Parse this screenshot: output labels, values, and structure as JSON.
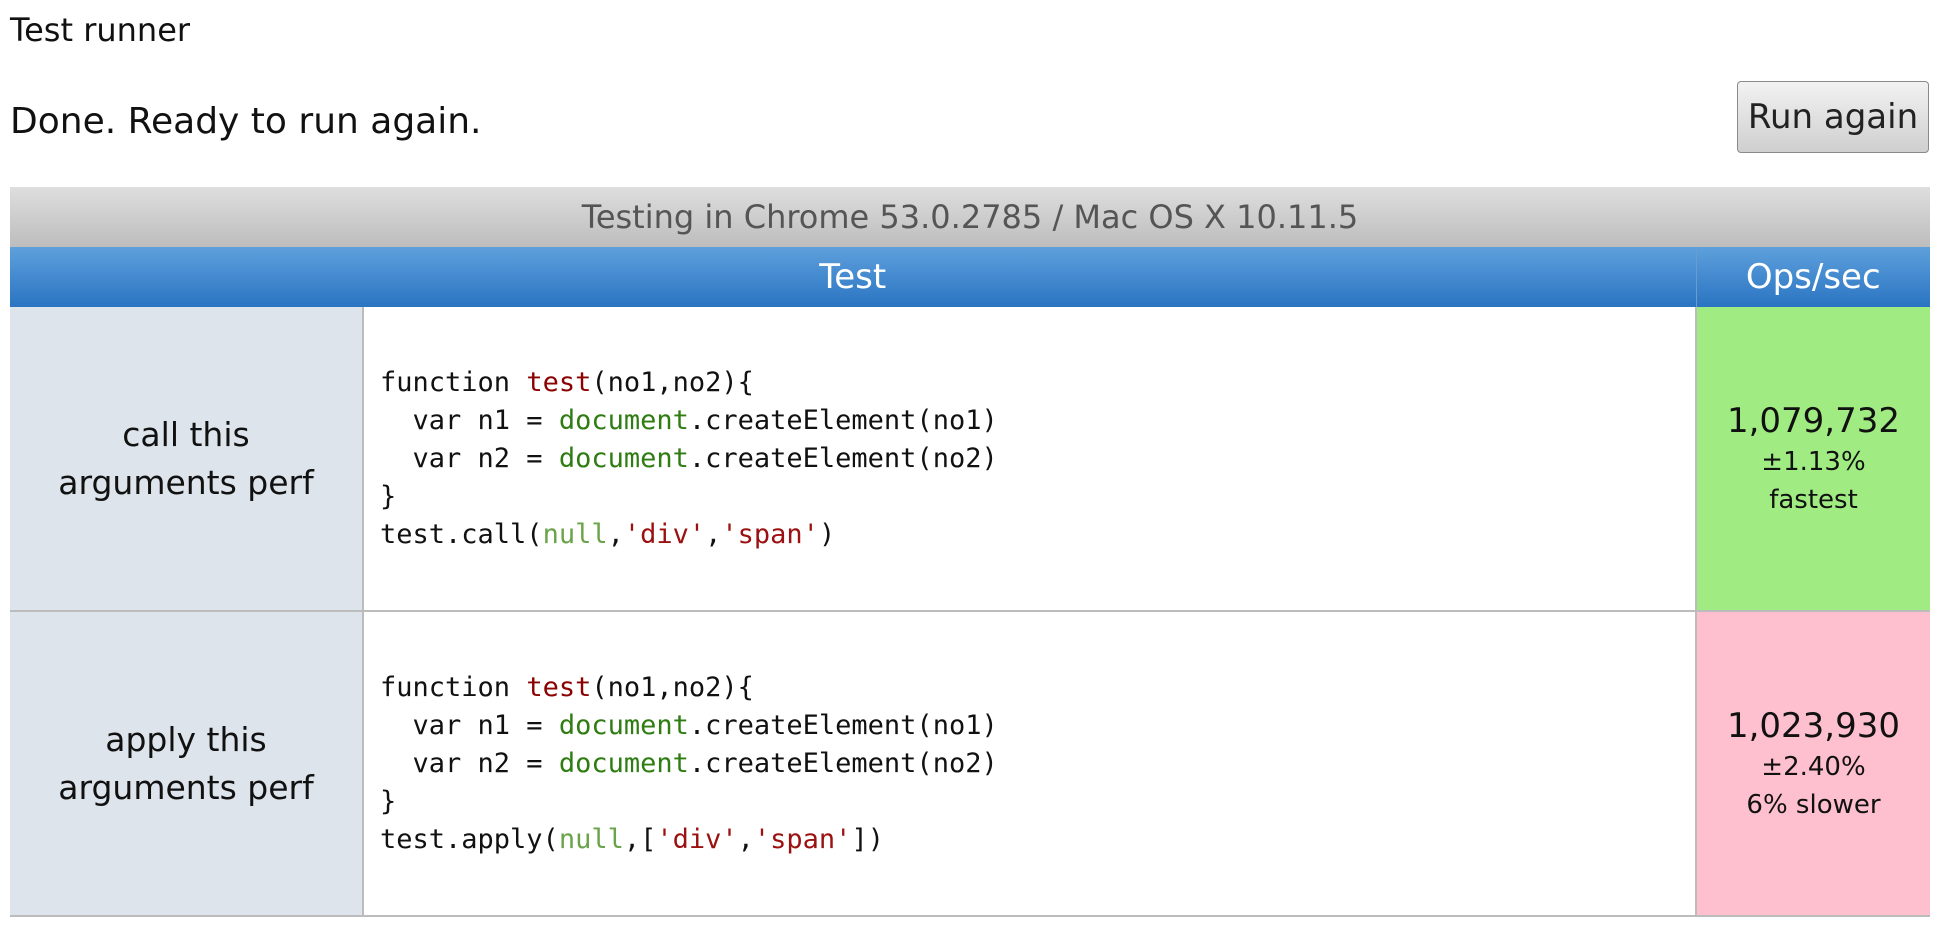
{
  "header": {
    "title": "Test runner",
    "status": "Done. Ready to run again.",
    "run_button_label": "Run again"
  },
  "table": {
    "environment": "Testing in Chrome 53.0.2785 / Mac OS X 10.11.5",
    "columns": {
      "test": "Test",
      "ops": "Ops/sec"
    },
    "rows": [
      {
        "name": "call this arguments perf",
        "code": {
          "line1_kw": "function ",
          "line1_fn": "test",
          "line1_rest": "(no1,no2){",
          "line2_pre": "  var n1 = ",
          "line2_obj": "document",
          "line2_rest": ".createElement(no1)",
          "line3_pre": "  var n2 = ",
          "line3_obj": "document",
          "line3_rest": ".createElement(no2)",
          "line4": "}",
          "line5_pre": "test.call(",
          "line5_null": "null",
          "line5_sep1": ",",
          "line5_str1": "'div'",
          "line5_sep2": ",",
          "line5_str2": "'span'",
          "line5_end": ")"
        },
        "ops": "1,079,732",
        "error": "±1.13%",
        "note": "fastest",
        "status": "fastest",
        "status_color": "#a0ec82"
      },
      {
        "name": "apply this arguments perf",
        "code": {
          "line1_kw": "function ",
          "line1_fn": "test",
          "line1_rest": "(no1,no2){",
          "line2_pre": "  var n1 = ",
          "line2_obj": "document",
          "line2_rest": ".createElement(no1)",
          "line3_pre": "  var n2 = ",
          "line3_obj": "document",
          "line3_rest": ".createElement(no2)",
          "line4": "}",
          "line5_pre": "test.apply(",
          "line5_null": "null",
          "line5_sep1": ",[",
          "line5_str1": "'div'",
          "line5_sep2": ",",
          "line5_str2": "'span'",
          "line5_end": "])"
        },
        "ops": "1,023,930",
        "error": "±2.40%",
        "note": "6% slower",
        "status": "slower",
        "status_color": "#fec0cf"
      }
    ]
  },
  "colors": {
    "header_blue": "#2a74c2",
    "env_gray": "#bdbdbd",
    "name_cell_bg": "#dde4eb",
    "code_function_name": "#8b0000",
    "code_global_object": "#2f7d12",
    "code_null": "#6aa34a",
    "code_string": "#9b1010"
  }
}
